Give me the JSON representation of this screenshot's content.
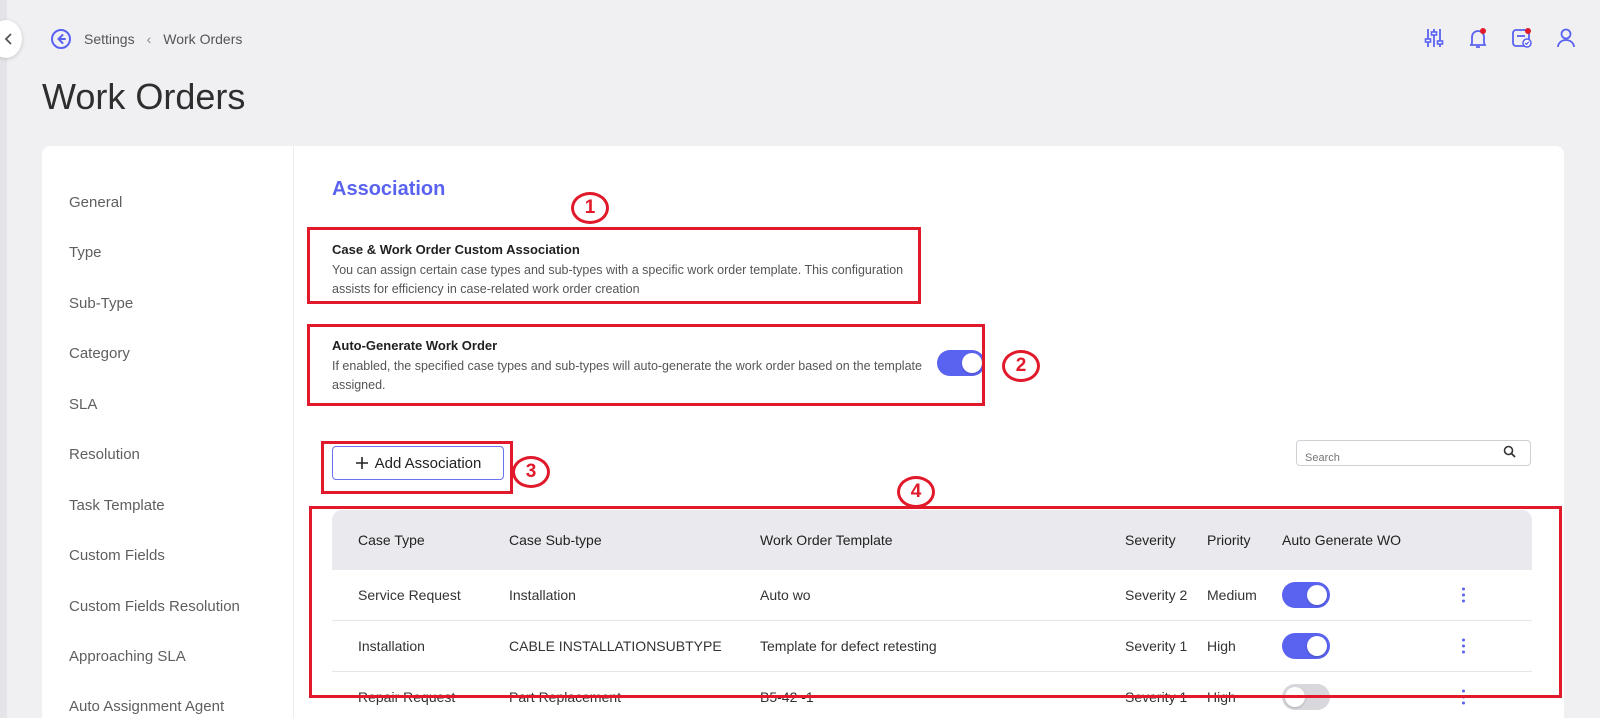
{
  "breadcrumb": {
    "parent": "Settings",
    "current": "Work Orders"
  },
  "page_title": "Work Orders",
  "sidebar": {
    "items": [
      {
        "label": "General"
      },
      {
        "label": "Type"
      },
      {
        "label": "Sub-Type"
      },
      {
        "label": "Category"
      },
      {
        "label": "SLA"
      },
      {
        "label": "Resolution"
      },
      {
        "label": "Task Template"
      },
      {
        "label": "Custom Fields"
      },
      {
        "label": "Custom Fields Resolution"
      },
      {
        "label": "Approaching SLA"
      },
      {
        "label": "Auto Assignment Agent"
      }
    ]
  },
  "section": {
    "title": "Association",
    "custom_association": {
      "title": "Case & Work Order Custom Association",
      "desc_line1": "You can assign certain case types and sub-types with a specific work order template. This configuration",
      "desc_line2": "assists for efficiency in case-related work order creation"
    },
    "auto_generate": {
      "title": "Auto-Generate Work Order",
      "desc_line1": "If enabled, the specified case types and sub-types will auto-generate the work order based on the template",
      "desc_line2": "assigned.",
      "enabled": true
    },
    "add_button_label": "Add Association",
    "search_placeholder": "Search"
  },
  "table": {
    "headers": [
      "Case Type",
      "Case Sub-type",
      "Work Order Template",
      "Severity",
      "Priority",
      "Auto Generate WO"
    ],
    "rows": [
      {
        "case_type": "Service Request",
        "sub_type": "Installation",
        "template": "Auto wo",
        "severity": "Severity 2",
        "priority": "Medium",
        "auto": true
      },
      {
        "case_type": "Installation",
        "sub_type": "CABLE INSTALLATIONSUBTYPE",
        "template": "Template for defect retesting",
        "severity": "Severity 1",
        "priority": "High",
        "auto": true
      },
      {
        "case_type": "Repair Request",
        "sub_type": "Part Replacement",
        "template": "B5-42 -1",
        "severity": "Severity 1",
        "priority": "High",
        "auto": false
      }
    ]
  },
  "annotations": [
    "1",
    "2",
    "3",
    "4"
  ],
  "colors": {
    "accent": "#5a63f0",
    "annotation": "#e11a2b",
    "toggle_off": "#d7d7dc"
  },
  "icons": [
    "chevron-left-icon",
    "back-arrow-circle-icon",
    "sliders-icon",
    "bell-icon",
    "calendar-check-icon",
    "user-icon",
    "search-icon",
    "plus-icon",
    "kebab-icon"
  ]
}
